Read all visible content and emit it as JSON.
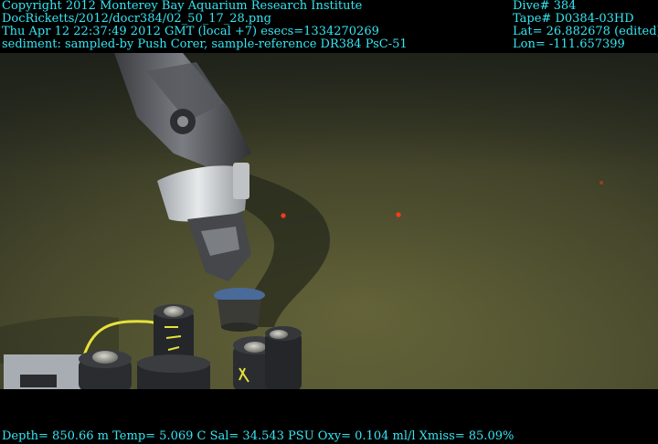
{
  "overlay": {
    "top_left": [
      "Copyright 2012 Monterey Bay Aquarium Research Institute",
      "DocRicketts/2012/docr384/02_50_17_28.png",
      "Thu Apr 12 22:37:49 2012 GMT (local +7)  esecs=1334270269",
      "sediment: sampled-by Push Corer, sample-reference DR384 PsC-51"
    ],
    "top_right": [
      "Dive# 384",
      "Tape# D0384-03HD",
      "Lat= 26.882678 (edited)",
      "Lon= -111.657399"
    ],
    "bottom": "Depth= 850.66 m  Temp= 5.069 C  Sal= 34.543 PSU  Oxy= 0.104 ml/l  Xmiss= 85.09%"
  },
  "colors": {
    "overlay_text": "#35e6f2",
    "seafloor": "#5a5a32",
    "laser_dot": "#ff3a1a"
  }
}
